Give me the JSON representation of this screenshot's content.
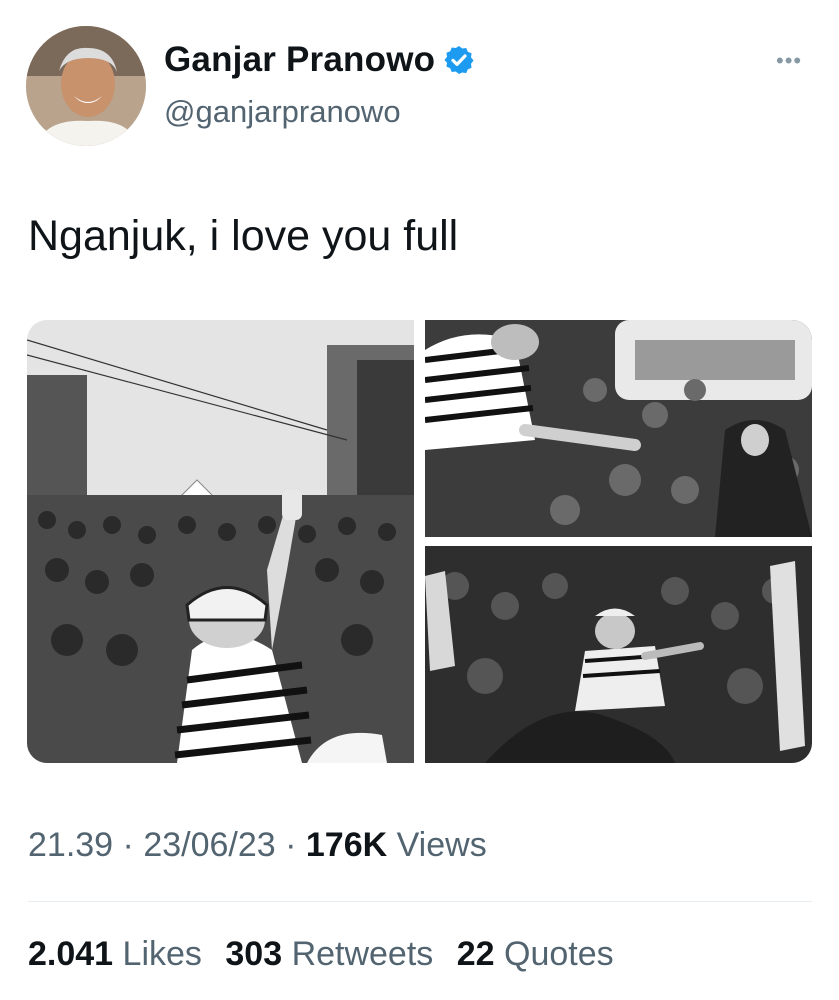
{
  "user": {
    "name": "Ganjar Pranowo",
    "handle": "@ganjarpranowo",
    "verified_color": "#1d9bf0"
  },
  "more_label": "•••",
  "tweet": {
    "text": "Nganjuk, i love you full"
  },
  "media": {
    "count": 3,
    "style": "black-and-white photos",
    "photo2_tag": "ganjar"
  },
  "meta": {
    "time": "21.39",
    "sep1": " · ",
    "date": "23/06/23",
    "sep2": " · ",
    "views_count": "176K",
    "views_label": " Views"
  },
  "stats": {
    "likes_count": "2.041",
    "likes_label": "Likes",
    "retweets_count": "303",
    "retweets_label": "Retweets",
    "quotes_count": "22",
    "quotes_label": "Quotes"
  }
}
